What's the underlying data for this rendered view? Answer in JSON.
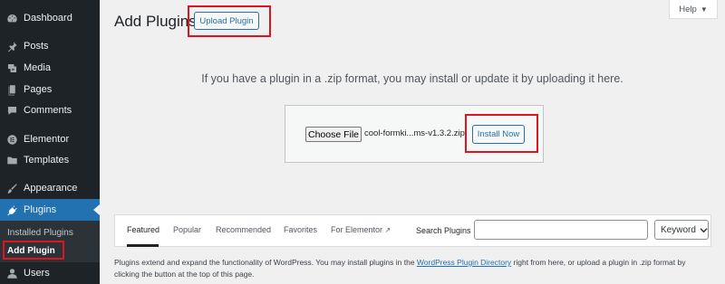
{
  "sidebar": {
    "items": [
      {
        "label": "Dashboard",
        "icon": "dashboard-icon"
      },
      {
        "label": "Posts",
        "icon": "pin-icon"
      },
      {
        "label": "Media",
        "icon": "media-icon"
      },
      {
        "label": "Pages",
        "icon": "page-icon"
      },
      {
        "label": "Comments",
        "icon": "comment-icon"
      },
      {
        "label": "Elementor",
        "icon": "elementor-icon"
      },
      {
        "label": "Templates",
        "icon": "folder-icon"
      },
      {
        "label": "Appearance",
        "icon": "brush-icon"
      },
      {
        "label": "Plugins",
        "icon": "plug-icon"
      },
      {
        "label": "Users",
        "icon": "user-icon"
      }
    ],
    "submenu": {
      "installed": "Installed Plugins",
      "add_new": "Add Plugin"
    }
  },
  "header": {
    "title": "Add Plugins",
    "upload_button": "Upload Plugin",
    "help": "Help"
  },
  "upload": {
    "description": "If you have a plugin in a .zip format, you may install or update it by uploading it here.",
    "choose_file": "Choose File",
    "file_name": "cool-formki...ms-v1.3.2.zip",
    "install_button": "Install Now"
  },
  "filters": {
    "tabs": [
      "Featured",
      "Popular",
      "Recommended",
      "Favorites",
      "For Elementor"
    ],
    "search_label": "Search Plugins",
    "search_value": "",
    "select_value": "Keyword"
  },
  "footer": {
    "text_before": "Plugins extend and expand the functionality of WordPress. You may install plugins in the ",
    "link": "WordPress Plugin Directory",
    "text_after": " right from here, or upload a plugin in .zip format by clicking the button at the top of this page."
  },
  "colors": {
    "sidebar_bg": "#1d2327",
    "accent": "#2271b1",
    "highlight_red": "#e0141e"
  }
}
